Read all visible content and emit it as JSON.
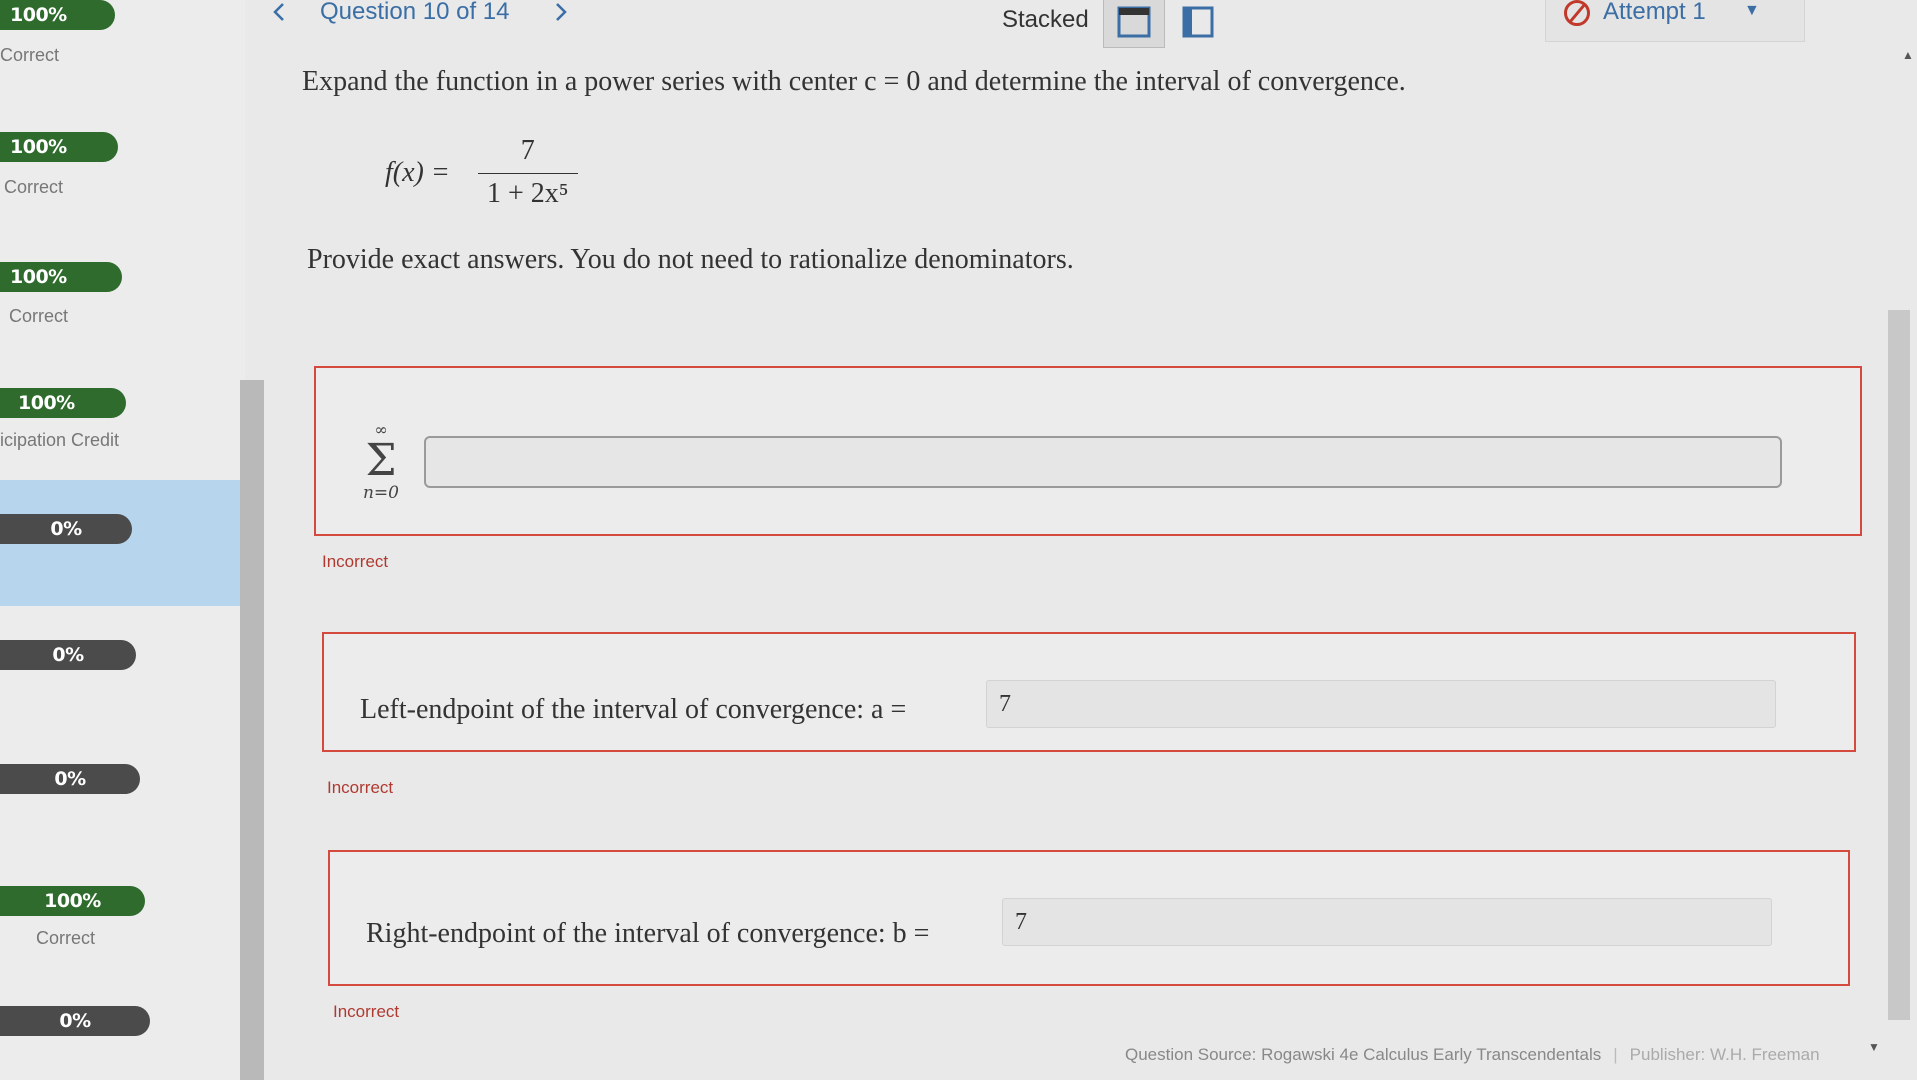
{
  "sidebar": {
    "items": [
      {
        "score": "100%",
        "status": "Correct",
        "style": "green"
      },
      {
        "score": "100%",
        "status": "Correct",
        "style": "green"
      },
      {
        "score": "100%",
        "status": "Correct",
        "style": "green"
      },
      {
        "score": "100%",
        "status": "icipation Credit",
        "style": "green"
      },
      {
        "score": "0%",
        "status": "",
        "style": "dark",
        "active": true
      },
      {
        "score": "0%",
        "status": "",
        "style": "dark"
      },
      {
        "score": "0%",
        "status": "",
        "style": "dark"
      },
      {
        "score": "100%",
        "status": "Correct",
        "style": "green"
      },
      {
        "score": "0%",
        "status": "",
        "style": "dark"
      }
    ]
  },
  "header": {
    "question_title": "Question 10 of 14",
    "view_label": "Stacked",
    "attempt_label": "Attempt 1"
  },
  "question": {
    "prompt": "Expand the function in a power series with center c = 0 and determine the interval of convergence.",
    "function_lhs": "f(x) =",
    "numerator": "7",
    "denominator": "1 + 2x⁵",
    "instructions": "Provide exact answers. You do not need to rationalize denominators."
  },
  "answers": {
    "series": {
      "sigma_upper": "∞",
      "sigma_symbol": "Σ",
      "sigma_lower": "n=0",
      "value": "",
      "status": "Incorrect"
    },
    "left_endpoint": {
      "label": "Left-endpoint of the interval of convergence: a =",
      "value": "7",
      "status": "Incorrect"
    },
    "right_endpoint": {
      "label": "Right-endpoint of the interval of convergence: b =",
      "value": "7",
      "status": "Incorrect"
    }
  },
  "footer": {
    "source": "Question Source: Rogawski 4e Calculus Early Transcendentals",
    "publisher": "Publisher: W.H. Freeman"
  },
  "colors": {
    "accent": "#3a6ea5",
    "error": "#d44a3f",
    "pill_green": "#2e6b2c",
    "pill_dark": "#4b4b4b",
    "active_item": "#b7d6ee"
  }
}
